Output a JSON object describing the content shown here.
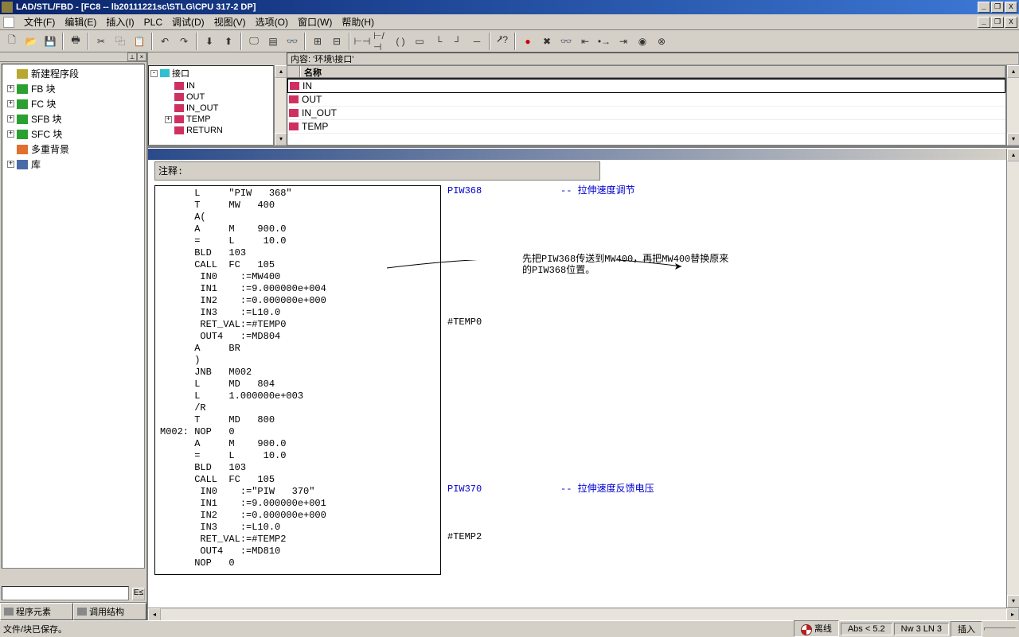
{
  "title": "LAD/STL/FBD  - [FC8 -- lb20111221sc\\STLG\\CPU 317-2 DP]",
  "menu": {
    "items": [
      "文件(F)",
      "编辑(E)",
      "插入(I)",
      "PLC",
      "调试(D)",
      "视图(V)",
      "选项(O)",
      "窗口(W)",
      "帮助(H)"
    ]
  },
  "left_tree": {
    "items": [
      {
        "icon": "icon-seg",
        "label": "新建程序段",
        "exp": ""
      },
      {
        "icon": "icon-fb",
        "label": "FB 块",
        "exp": "+"
      },
      {
        "icon": "icon-fc",
        "label": "FC 块",
        "exp": "+"
      },
      {
        "icon": "icon-sfb",
        "label": "SFB 块",
        "exp": "+"
      },
      {
        "icon": "icon-sfc",
        "label": "SFC 块",
        "exp": "+"
      },
      {
        "icon": "icon-multi",
        "label": "多重背景",
        "exp": ""
      },
      {
        "icon": "icon-lib",
        "label": "库",
        "exp": "+"
      }
    ]
  },
  "left_tabs": {
    "a": "程序元素",
    "b": "调用结构"
  },
  "upper": {
    "content_label": "内容:    '环境\\接口'",
    "if_root": "接口",
    "if_items": [
      {
        "icon": "icon-io",
        "label": "IN",
        "exp": ""
      },
      {
        "icon": "icon-io",
        "label": "OUT",
        "exp": ""
      },
      {
        "icon": "icon-io",
        "label": "IN_OUT",
        "exp": ""
      },
      {
        "icon": "icon-io",
        "label": "TEMP",
        "exp": "+"
      },
      {
        "icon": "icon-io",
        "label": "RETURN",
        "exp": ""
      }
    ],
    "grid_header": "名称",
    "grid_rows": [
      "IN",
      "OUT",
      "IN_OUT",
      "TEMP"
    ]
  },
  "editor": {
    "comment_label": "注释:",
    "code_lines": [
      "      L     \"PIW   368\"",
      "      T     MW   400",
      "      A(",
      "      A     M    900.0",
      "      =     L     10.0",
      "      BLD   103",
      "      CALL  FC   105",
      "       IN0    :=MW400",
      "       IN1    :=9.000000e+004",
      "       IN2    :=0.000000e+000",
      "       IN3    :=L10.0",
      "       RET_VAL:=#TEMP0",
      "       OUT4   :=MD804",
      "      A     BR",
      "      )",
      "      JNB   M002",
      "      L     MD   804",
      "      L     1.000000e+003",
      "      /R",
      "      T     MD   800",
      "M002: NOP   0",
      "      A     M    900.0",
      "      =     L     10.0",
      "      BLD   103",
      "      CALL  FC   105",
      "       IN0    :=\"PIW   370\"",
      "       IN1    :=9.000000e+001",
      "       IN2    :=0.000000e+000",
      "       IN3    :=L10.0",
      "       RET_VAL:=#TEMP2",
      "       OUT4   :=MD810",
      "      NOP   0"
    ],
    "symbols": {
      "0": "PIW368",
      "11": "#TEMP0",
      "25": "PIW370",
      "29": "#TEMP2"
    },
    "sym_comments": {
      "0": "-- 拉伸速度调节",
      "25": "-- 拉伸速度反馈电压"
    },
    "annotation": "先把PIW368传送到MW400，再把MW400替换原来的PIW368位置。"
  },
  "status": {
    "left": "文件/块已保存。",
    "offline": "离线",
    "abs": "Abs < 5.2",
    "nw": "Nw 3 LN 3",
    "insert": "插入"
  }
}
